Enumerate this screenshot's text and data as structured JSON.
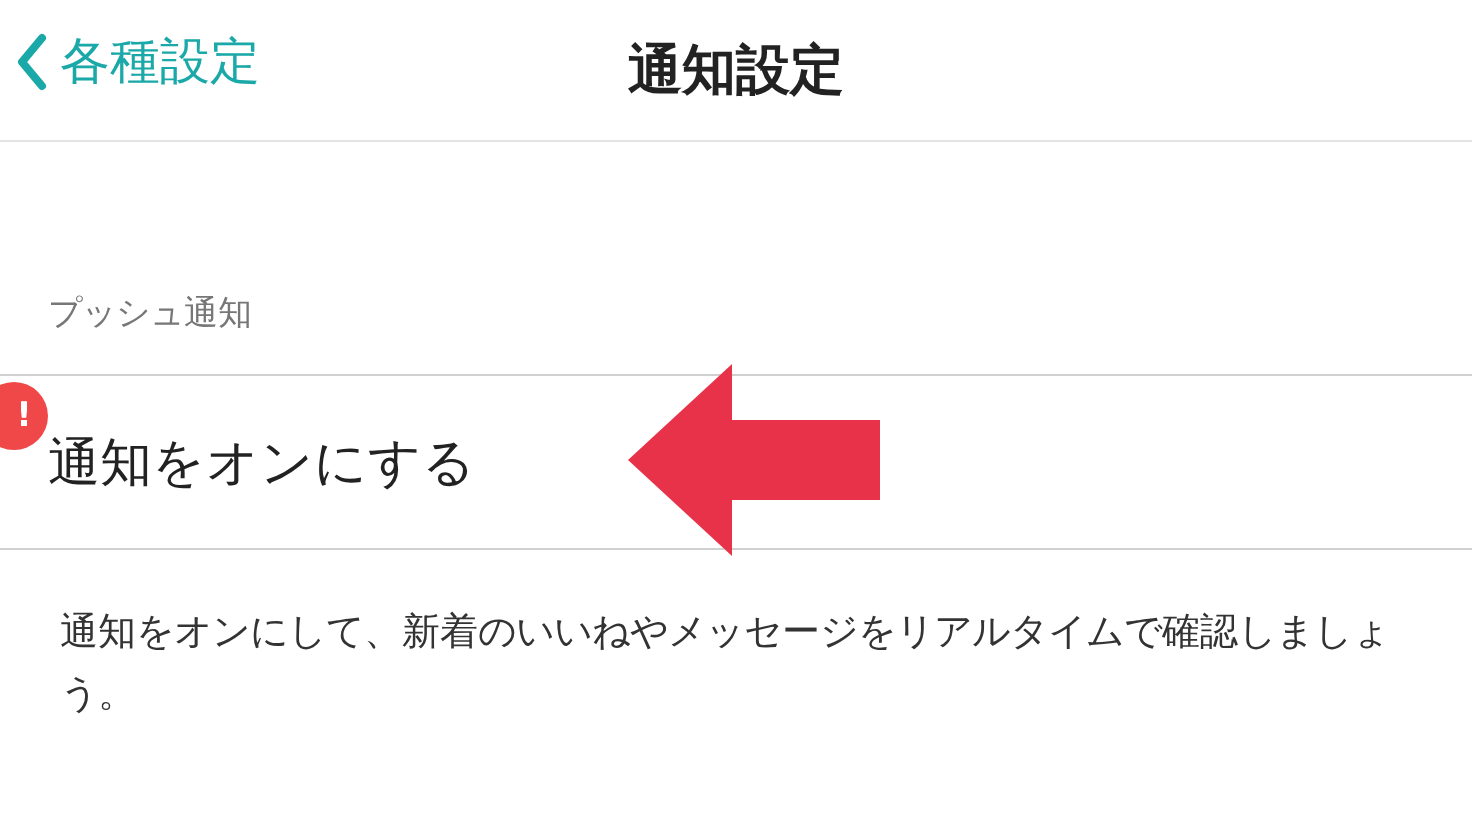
{
  "nav_bar": {
    "back_label": "各種設定",
    "title": "通知設定"
  },
  "section": {
    "header": "プッシュ通知",
    "row": {
      "label": "通知をオンにする",
      "badge": "!"
    },
    "footer": "通知をオンにして、新着のいいねやメッセージをリアルタイムで確認しましょう。"
  }
}
